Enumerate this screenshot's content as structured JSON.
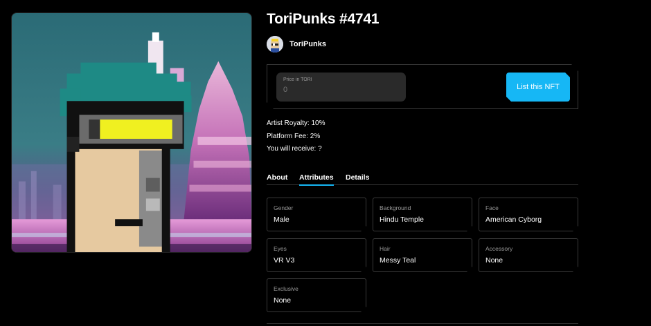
{
  "nft": {
    "title": "ToriPunks #4741",
    "collection_name": "ToriPunks"
  },
  "listing": {
    "price_label": "Price in TORI",
    "price_placeholder": "0",
    "list_button": "List this NFT"
  },
  "fees": {
    "royalty": "Artist Royalty: 10%",
    "platform": "Platform Fee: 2%",
    "receive": "You will receive: ?"
  },
  "tabs": [
    {
      "label": "About",
      "active": false
    },
    {
      "label": "Attributes",
      "active": true
    },
    {
      "label": "Details",
      "active": false
    }
  ],
  "attributes": [
    {
      "key": "Gender",
      "value": "Male"
    },
    {
      "key": "Background",
      "value": "Hindu Temple"
    },
    {
      "key": "Face",
      "value": "American Cyborg"
    },
    {
      "key": "Eyes",
      "value": "VR V3"
    },
    {
      "key": "Hair",
      "value": "Messy Teal"
    },
    {
      "key": "Accessory",
      "value": "None"
    },
    {
      "key": "Exclusive",
      "value": "None"
    }
  ],
  "colors": {
    "accent": "#16b7f5",
    "background": "#000000",
    "border": "#3a3a3a"
  },
  "icons": {
    "collection_avatar": "punk-avatar-icon"
  }
}
